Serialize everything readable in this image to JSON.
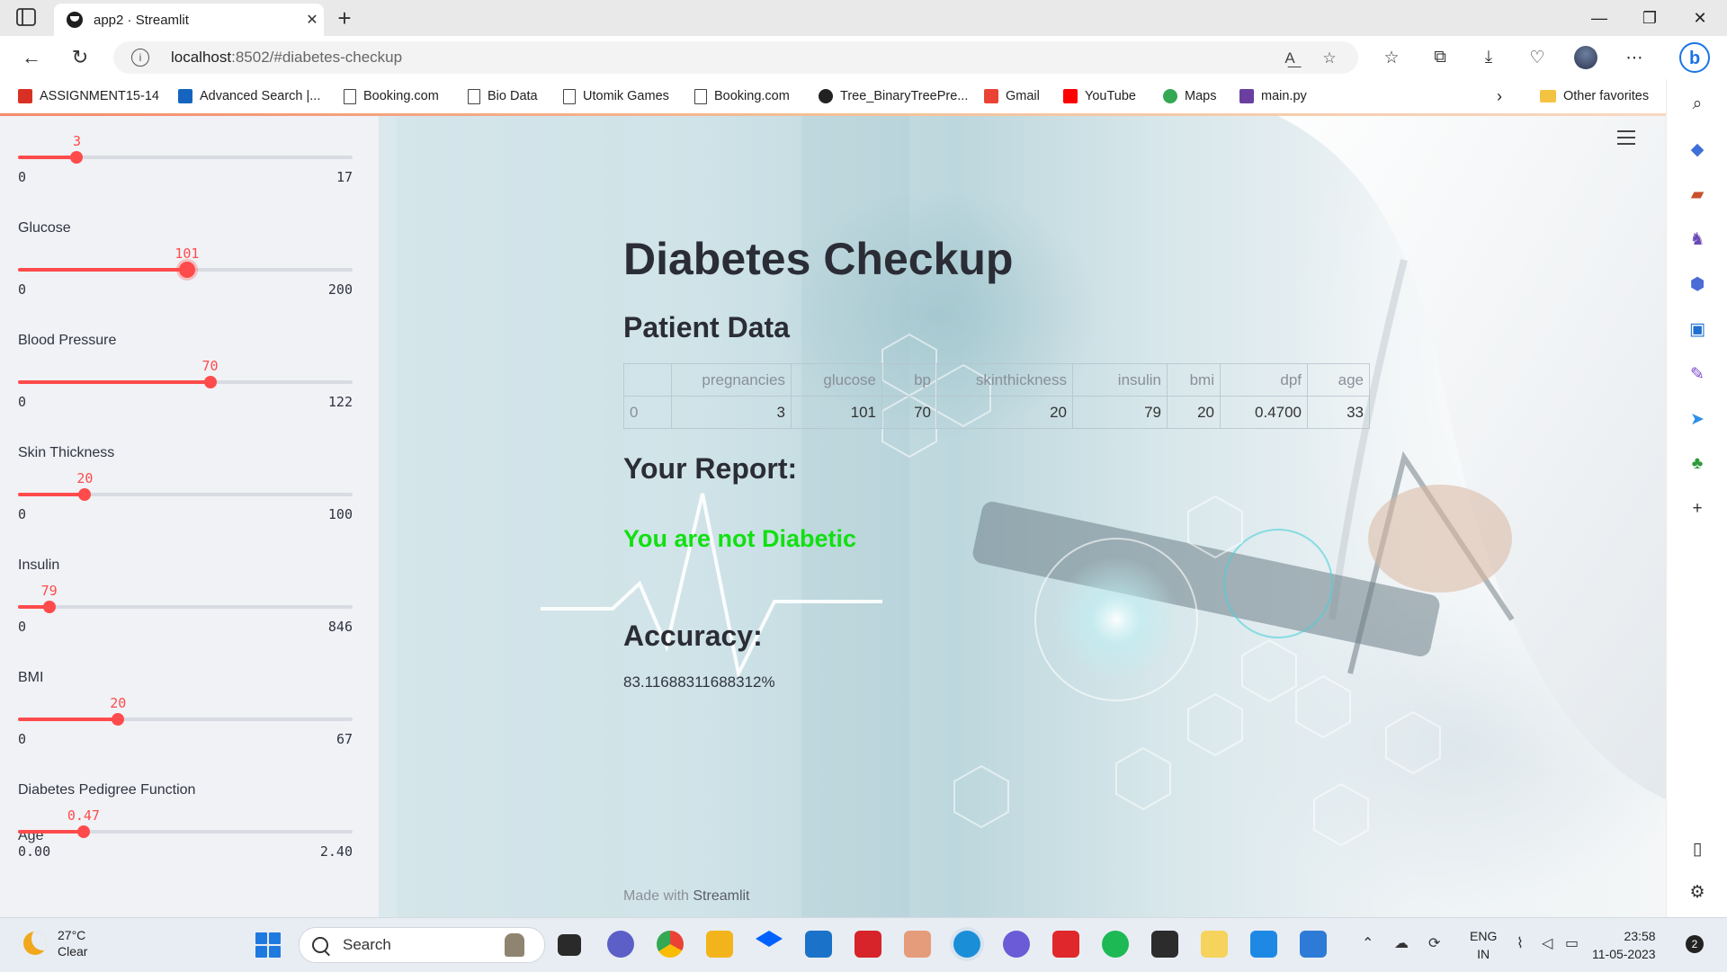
{
  "browser": {
    "tab_title": "app2 · Streamlit",
    "url_host": "localhost",
    "url_rest": ":8502/#diabetes-checkup",
    "favorites": [
      {
        "label": "ASSIGNMENT15-14",
        "icon": "pdf-icon",
        "color": "#d93025"
      },
      {
        "label": "Advanced Search |...",
        "icon": "cb-icon",
        "color": "#1565c0"
      },
      {
        "label": "Booking.com",
        "icon": "page-icon",
        "color": "#444444"
      },
      {
        "label": "Bio Data",
        "icon": "page-icon",
        "color": "#444444"
      },
      {
        "label": "Utomik Games",
        "icon": "page-icon",
        "color": "#444444"
      },
      {
        "label": "Booking.com",
        "icon": "page-icon",
        "color": "#444444"
      },
      {
        "label": "Tree_BinaryTreePre...",
        "icon": "github-icon",
        "color": "#222222"
      },
      {
        "label": "Gmail",
        "icon": "gmail-icon",
        "color": "#ea4335"
      },
      {
        "label": "YouTube",
        "icon": "youtube-icon",
        "color": "#ff0000"
      },
      {
        "label": "Maps",
        "icon": "maps-icon",
        "color": "#34a853"
      },
      {
        "label": "main.py",
        "icon": "replit-icon",
        "color": "#6b3fa0"
      }
    ],
    "other_favorites": "Other favorites"
  },
  "sidebar": {
    "sliders": [
      {
        "label": "",
        "value": "3",
        "min": "0",
        "max": "17",
        "fraction": 0.176
      },
      {
        "label": "Glucose",
        "value": "101",
        "min": "0",
        "max": "200",
        "fraction": 0.505,
        "active": true
      },
      {
        "label": "Blood Pressure",
        "value": "70",
        "min": "0",
        "max": "122",
        "fraction": 0.574
      },
      {
        "label": "Skin Thickness",
        "value": "20",
        "min": "0",
        "max": "100",
        "fraction": 0.2
      },
      {
        "label": "Insulin",
        "value": "79",
        "min": "0",
        "max": "846",
        "fraction": 0.093
      },
      {
        "label": "BMI",
        "value": "20",
        "min": "0",
        "max": "67",
        "fraction": 0.299
      },
      {
        "label": "Diabetes Pedigree Function",
        "value": "0.47",
        "min": "0.00",
        "max": "2.40",
        "fraction": 0.196
      }
    ],
    "last_label": "Age"
  },
  "main": {
    "title": "Diabetes Checkup",
    "patient_heading": "Patient Data",
    "table": {
      "columns": [
        "",
        "pregnancies",
        "glucose",
        "bp",
        "skinthickness",
        "insulin",
        "bmi",
        "dpf",
        "age"
      ],
      "rows": [
        [
          "0",
          "3",
          "101",
          "70",
          "20",
          "79",
          "20",
          "0.4700",
          "33"
        ]
      ]
    },
    "report_heading": "Your Report:",
    "result": "You are not Diabetic",
    "result_color": "#11e011",
    "accuracy_heading": "Accuracy:",
    "accuracy_value": "83.11688311688312%",
    "footer_prefix": "Made with ",
    "footer_brand": "Streamlit"
  },
  "taskbar": {
    "temperature": "27°C",
    "condition": "Clear",
    "search": "Search",
    "lang_top": "ENG",
    "lang_bottom": "IN",
    "time": "23:58",
    "date": "11-05-2023",
    "notifications": "2"
  }
}
